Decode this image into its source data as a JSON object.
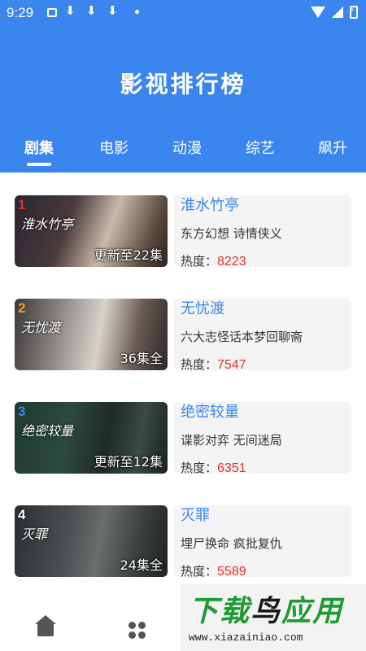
{
  "status_bar": {
    "time": "9:29"
  },
  "app": {
    "title": "影视排行榜"
  },
  "tabs": [
    {
      "label": "剧集",
      "active": true
    },
    {
      "label": "电影",
      "active": false
    },
    {
      "label": "动漫",
      "active": false
    },
    {
      "label": "综艺",
      "active": false
    },
    {
      "label": "飙升",
      "active": false
    }
  ],
  "items": [
    {
      "rank": "1",
      "rank_color": "#e0302b",
      "thumb_caption": "淮水竹亭",
      "episodes": "更新至22集",
      "title": "淮水竹亭",
      "tags": "东方幻想 诗情侠义",
      "heat_label": "热度：",
      "heat_value": "8223"
    },
    {
      "rank": "2",
      "rank_color": "#f0a020",
      "thumb_caption": "无忧渡",
      "episodes": "36集全",
      "title": "无忧渡",
      "tags": "六大志怪话本梦回聊斋",
      "heat_label": "热度：",
      "heat_value": "7547"
    },
    {
      "rank": "3",
      "rank_color": "#3b86ee",
      "thumb_caption": "绝密较量",
      "episodes": "更新至12集",
      "title": "绝密较量",
      "tags": "谍影对弈 无间迷局",
      "heat_label": "热度：",
      "heat_value": "6351"
    },
    {
      "rank": "4",
      "rank_color": "#222222",
      "thumb_caption": "灭罪",
      "episodes": "24集全",
      "title": "灭罪",
      "tags": "埋尸换命 疯批复仇",
      "heat_label": "热度：",
      "heat_value": "5589"
    }
  ],
  "watermark": {
    "logo_green": "下载",
    "logo_dark": "鸟",
    "logo_green2": "应用",
    "url": "www.xiazainiao.com"
  },
  "colors": {
    "header": "#3b86ee",
    "title_blue": "#3b86ee",
    "heat_red": "#e0302b",
    "card_bg": "#f4f4f4"
  }
}
